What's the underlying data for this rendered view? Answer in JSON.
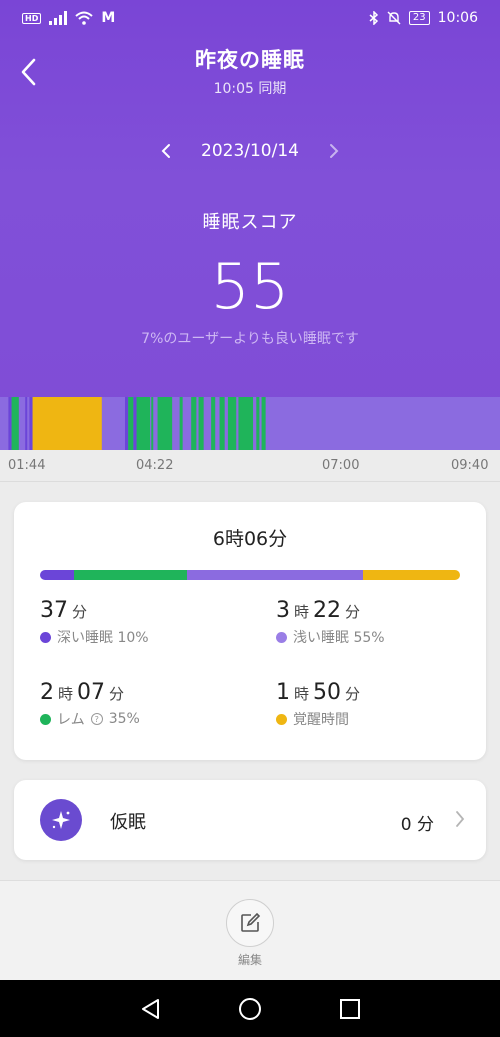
{
  "status_bar": {
    "hd": "HD",
    "carrier_icon": "M",
    "battery": "23",
    "time": "10:06"
  },
  "header": {
    "title": "昨夜の睡眠",
    "sync_text": "10:05 同期",
    "date": "2023/10/14"
  },
  "score": {
    "label": "睡眠スコア",
    "value": "55",
    "note": "7%のユーザーよりも良い睡眠です"
  },
  "timeline": {
    "colors": {
      "light": "#8b6be0",
      "deep": "#6b45d8",
      "rem": "#1fb45a",
      "awake": "#efb612"
    },
    "start": "01:44",
    "end": "09:40",
    "segments": [
      {
        "stage": "light",
        "from": "01:44",
        "to": "01:52"
      },
      {
        "stage": "deep",
        "from": "01:52",
        "to": "01:55"
      },
      {
        "stage": "rem",
        "from": "01:55",
        "to": "02:02"
      },
      {
        "stage": "light",
        "from": "02:02",
        "to": "02:08"
      },
      {
        "stage": "deep",
        "from": "02:08",
        "to": "02:10"
      },
      {
        "stage": "light",
        "from": "02:10",
        "to": "02:12"
      },
      {
        "stage": "deep",
        "from": "02:12",
        "to": "02:15"
      },
      {
        "stage": "awake",
        "from": "02:15",
        "to": "03:21"
      },
      {
        "stage": "light",
        "from": "03:21",
        "to": "03:43"
      },
      {
        "stage": "deep",
        "from": "03:43",
        "to": "03:46"
      },
      {
        "stage": "rem",
        "from": "03:46",
        "to": "03:51"
      },
      {
        "stage": "deep",
        "from": "03:51",
        "to": "03:54"
      },
      {
        "stage": "rem",
        "from": "03:54",
        "to": "04:07"
      },
      {
        "stage": "light",
        "from": "04:07",
        "to": "04:08"
      },
      {
        "stage": "rem",
        "from": "04:08",
        "to": "04:10"
      },
      {
        "stage": "light",
        "from": "04:10",
        "to": "04:14"
      },
      {
        "stage": "rem",
        "from": "04:14",
        "to": "04:28"
      },
      {
        "stage": "light",
        "from": "04:28",
        "to": "04:35"
      },
      {
        "stage": "rem",
        "from": "04:35",
        "to": "04:38"
      },
      {
        "stage": "light",
        "from": "04:38",
        "to": "04:46"
      },
      {
        "stage": "rem",
        "from": "04:46",
        "to": "04:51"
      },
      {
        "stage": "light",
        "from": "04:51",
        "to": "04:53"
      },
      {
        "stage": "rem",
        "from": "04:53",
        "to": "04:58"
      },
      {
        "stage": "light",
        "from": "04:58",
        "to": "05:05"
      },
      {
        "stage": "rem",
        "from": "05:05",
        "to": "05:09"
      },
      {
        "stage": "light",
        "from": "05:09",
        "to": "05:13"
      },
      {
        "stage": "rem",
        "from": "05:13",
        "to": "05:18"
      },
      {
        "stage": "light",
        "from": "05:18",
        "to": "05:21"
      },
      {
        "stage": "rem",
        "from": "05:21",
        "to": "05:29"
      },
      {
        "stage": "light",
        "from": "05:29",
        "to": "05:31"
      },
      {
        "stage": "rem",
        "from": "05:31",
        "to": "05:45"
      },
      {
        "stage": "light",
        "from": "05:45",
        "to": "05:48"
      },
      {
        "stage": "rem",
        "from": "05:48",
        "to": "05:51"
      },
      {
        "stage": "light",
        "from": "05:51",
        "to": "05:53"
      },
      {
        "stage": "rem",
        "from": "05:53",
        "to": "05:57"
      },
      {
        "stage": "light",
        "from": "05:57",
        "to": "09:40"
      }
    ]
  },
  "time_axis": [
    "01:44",
    "04:22",
    "07:00",
    "09:40"
  ],
  "summary": {
    "total": "6時06分",
    "distribution": [
      {
        "stage": "deep",
        "percent": 8
      },
      {
        "stage": "rem",
        "percent": 27
      },
      {
        "stage": "light",
        "percent": 42
      },
      {
        "stage": "awake",
        "percent": 23
      }
    ],
    "stats": {
      "deep": {
        "min": "37",
        "min_unit": "分",
        "label": "深い睡眠 10%",
        "color": "#6b45d8"
      },
      "light": {
        "hour": "3",
        "hour_unit": "時",
        "min": "22",
        "min_unit": "分",
        "label": "浅い睡眠 55%",
        "color": "#9a7ee6"
      },
      "rem": {
        "hour": "2",
        "hour_unit": "時",
        "min": "07",
        "min_unit": "分",
        "label": "レム",
        "percent": "35%",
        "color": "#1fb45a"
      },
      "awake": {
        "hour": "1",
        "hour_unit": "時",
        "min": "50",
        "min_unit": "分",
        "label": "覚醒時間",
        "color": "#efb612"
      }
    }
  },
  "nap": {
    "label": "仮眠",
    "value": "0 分",
    "icon": "sparkle-icon",
    "icon_bg": "#6a4bd0"
  },
  "bottom": {
    "edit_label": "編集"
  }
}
